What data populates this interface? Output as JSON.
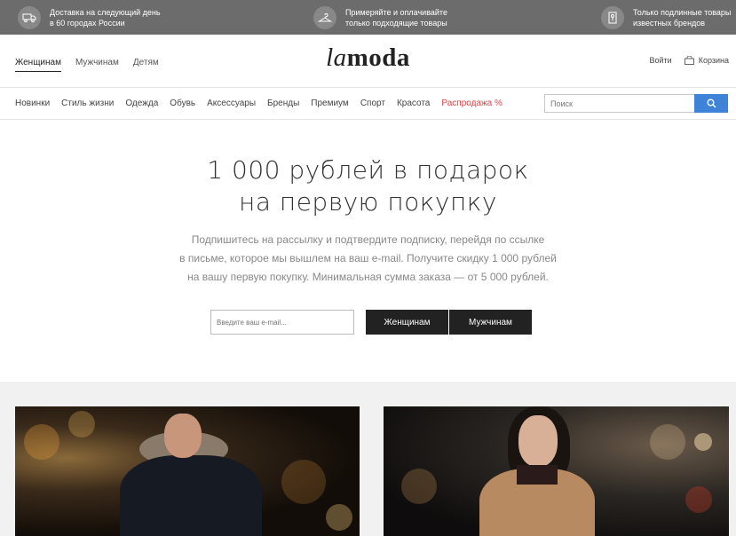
{
  "topbar": {
    "items": [
      {
        "icon": "delivery-truck-icon",
        "line1": "Доставка на следующий день",
        "line2": "в 60 городах России"
      },
      {
        "icon": "hanger-icon",
        "line1": "Примеряйте и оплачивайте",
        "line2": "только подходящие товары"
      },
      {
        "icon": "genuine-tag-icon",
        "line1": "Только подлинные товары",
        "line2": "известных брендов"
      }
    ]
  },
  "header": {
    "gender_tabs": [
      "Женщинам",
      "Мужчинам",
      "Детям"
    ],
    "logo_part1": "la",
    "logo_part2": "moda",
    "login": "Войти",
    "cart": "Корзина"
  },
  "nav": {
    "categories": [
      "Новинки",
      "Стиль жизни",
      "Одежда",
      "Обувь",
      "Аксессуары",
      "Бренды",
      "Премиум",
      "Спорт",
      "Красота"
    ],
    "sale": "Распродажа %",
    "search_placeholder": "Поиск"
  },
  "promo": {
    "title_line1": "1 000 рублей в подарок",
    "title_line2": "на первую покупку",
    "text_line1": "Подпишитесь на рассылку и подтвердите подписку, перейдя по ссылке",
    "text_line2": "в письме, которое мы вышлем на ваш e-mail. Получите скидку 1 000 рублей",
    "text_line3": "на вашу первую покупку. Минимальная сумма заказа — от 5 000 рублей.",
    "email_placeholder": "Введите ваш e-mail...",
    "btn_women": "Женщинам",
    "btn_men": "Мужчинам"
  },
  "colors": {
    "topbar_bg": "#6c6c6c",
    "accent_blue": "#3e83d7",
    "sale_red": "#d9464b",
    "button_dark": "#222222"
  }
}
